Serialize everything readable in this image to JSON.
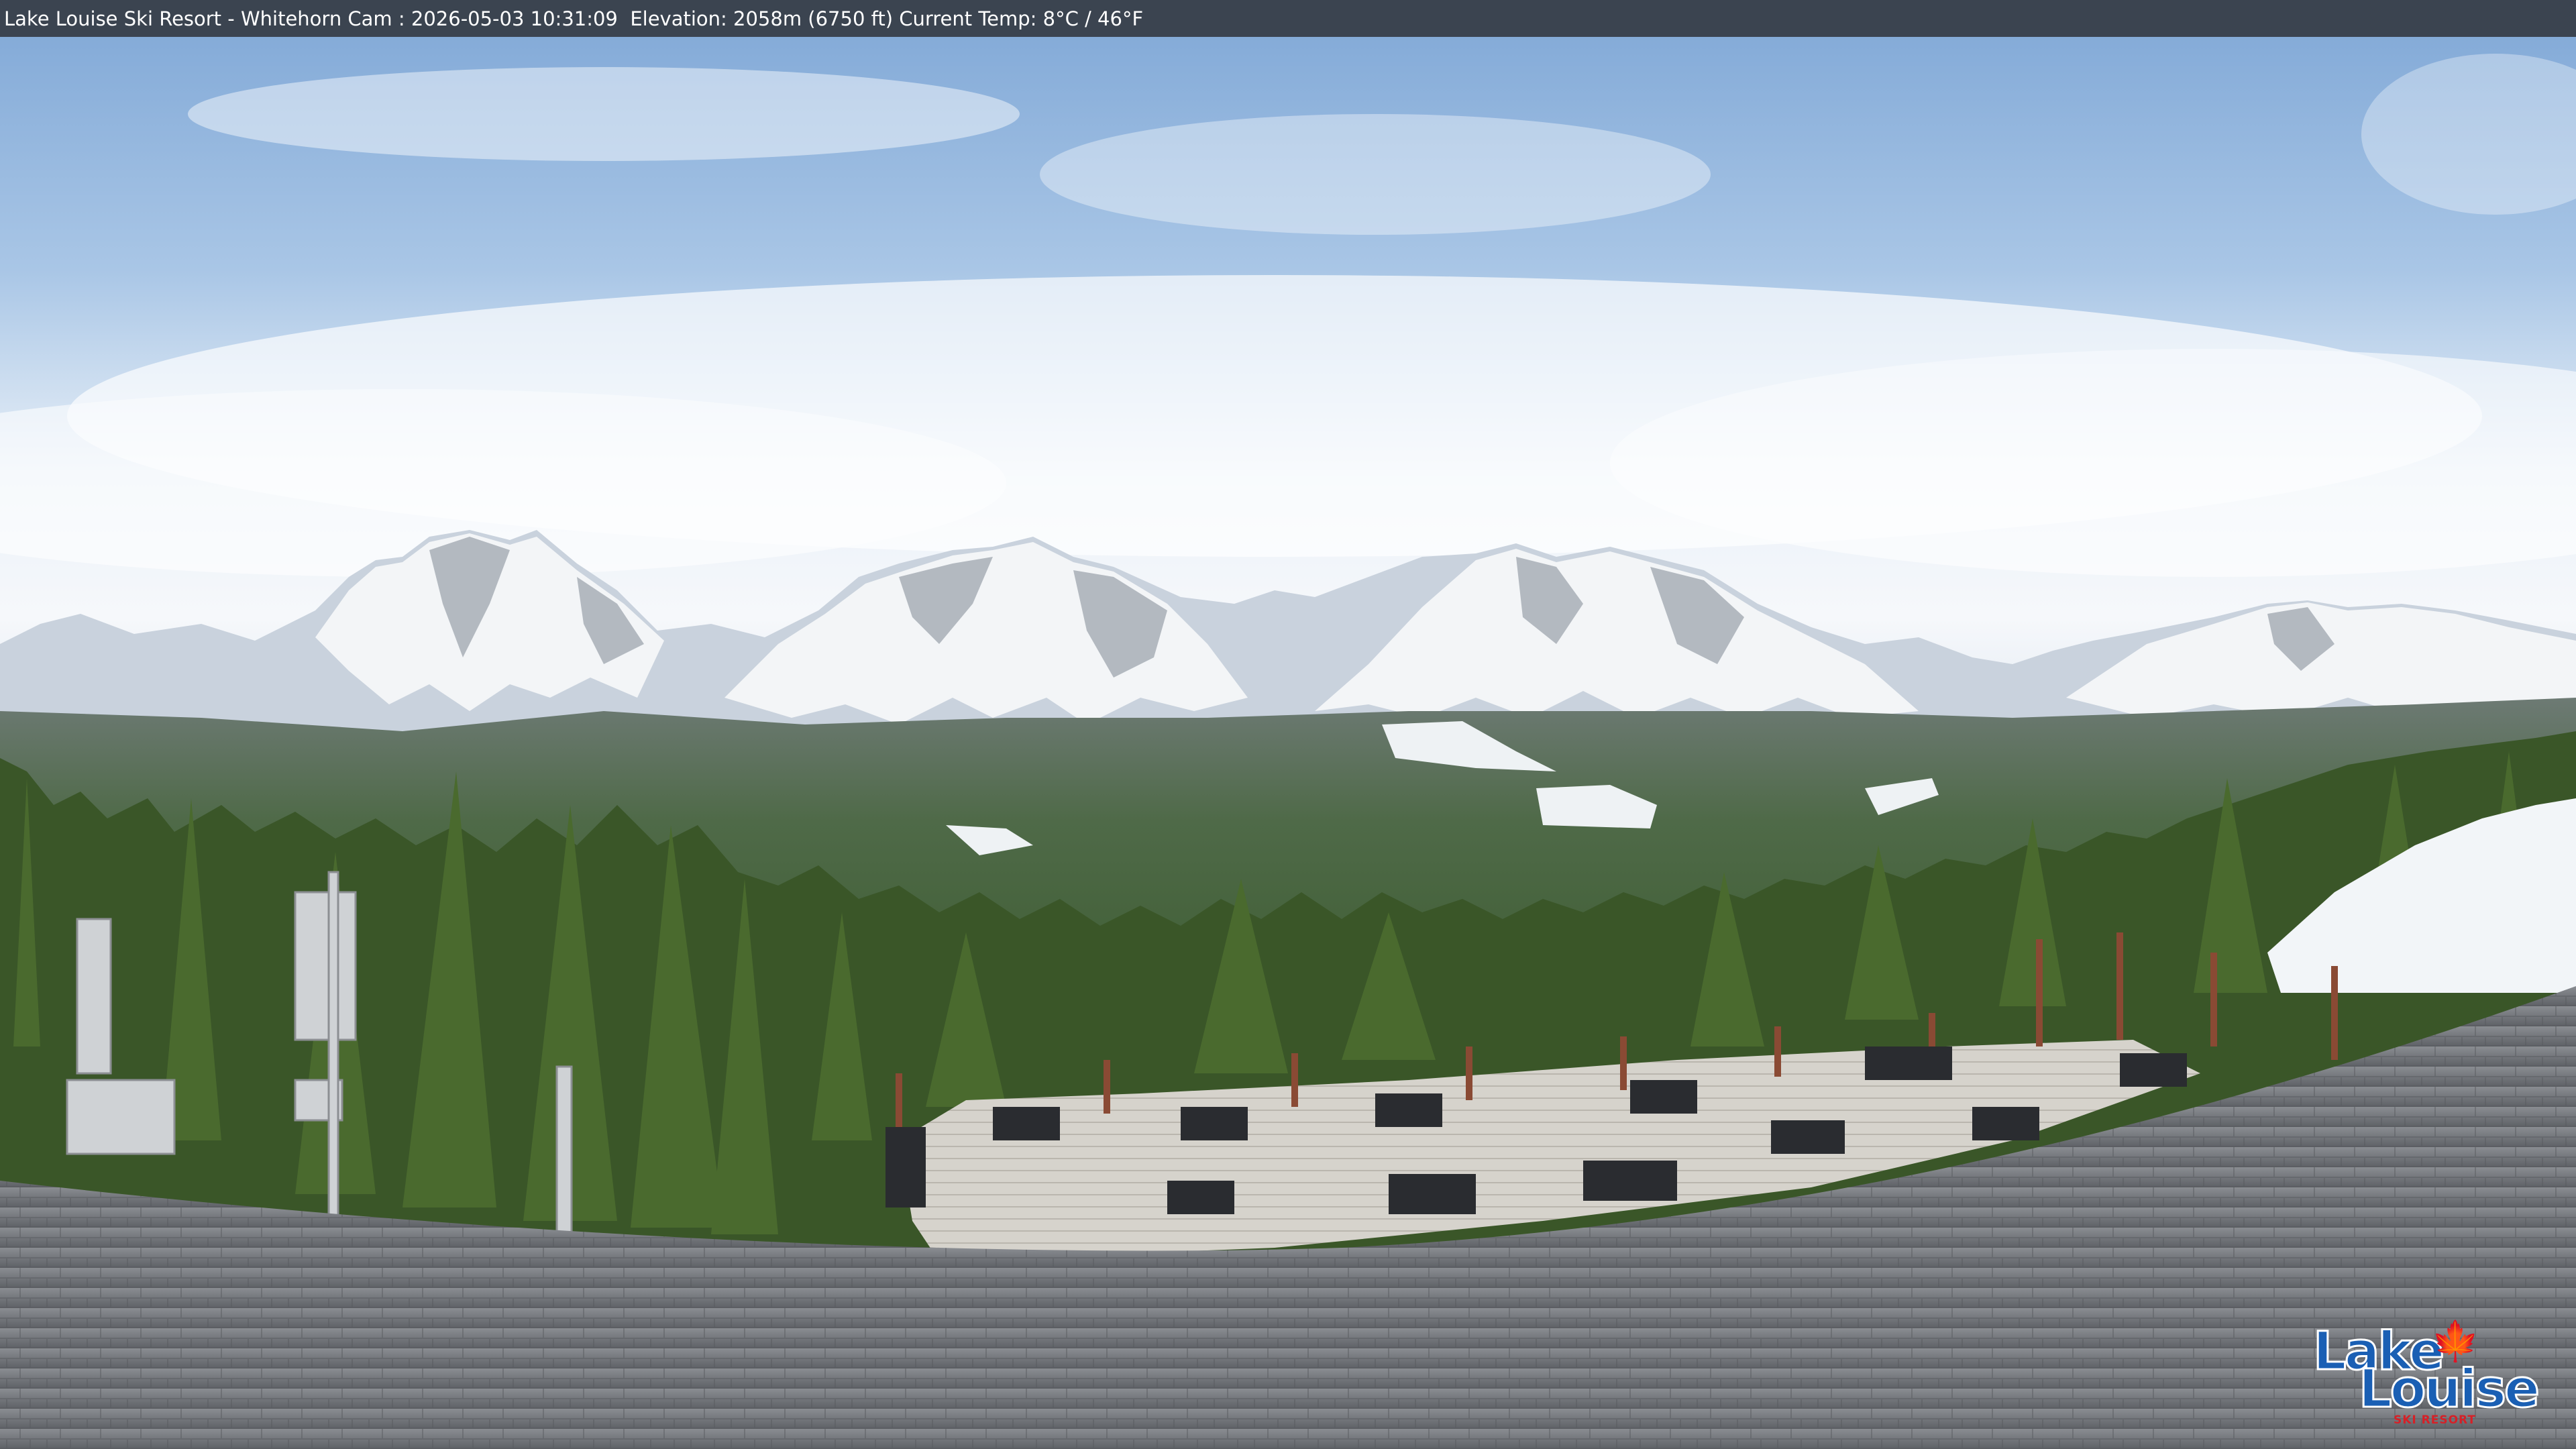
{
  "overlay": {
    "caption": "Lake Louise Ski Resort - Whitehorn Cam : 2026-05-03 10:31:09  Elevation: 2058m (6750 ft) Current Temp: 8°C / 46°F"
  },
  "logo": {
    "line1": "Lake",
    "line2": "Louise",
    "subtitle": "SKI RESORT",
    "leaf_icon": "maple-leaf-icon"
  },
  "colors": {
    "header_bg": "#3b4450",
    "logo_blue": "#1a5fb4",
    "logo_red": "#d62027",
    "sky_top": "#8fb3dc",
    "sky_haze": "#f4f7fb",
    "roof": "#6f7378",
    "deck": "#d9d6d0",
    "forest": "#3e5a2a"
  }
}
